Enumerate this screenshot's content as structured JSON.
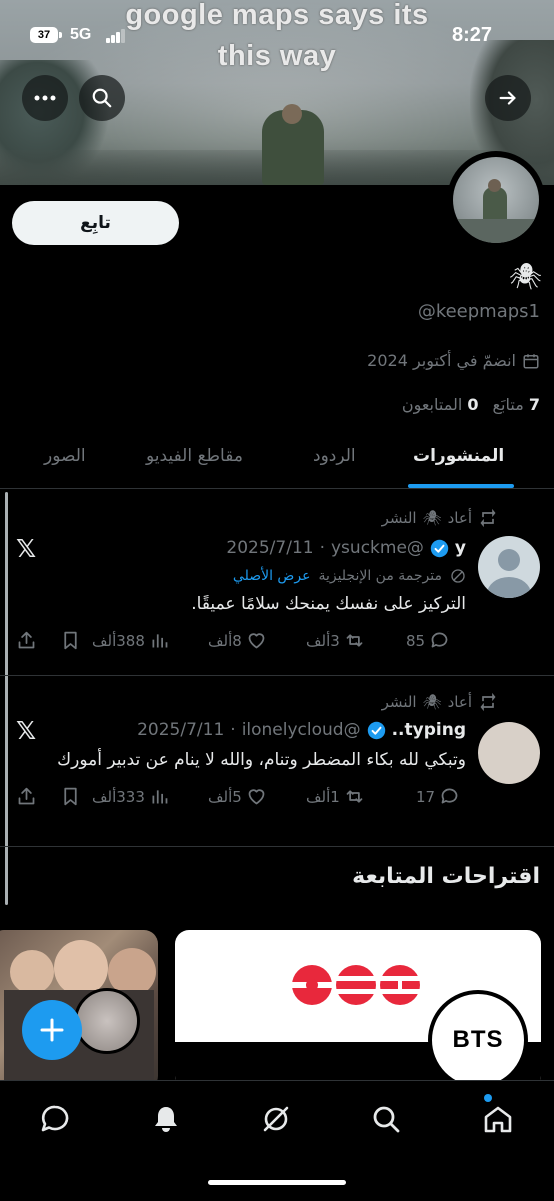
{
  "status_bar": {
    "time": "8:27",
    "battery": "37",
    "network": "5G"
  },
  "banner": {
    "line1": "google maps says its",
    "line2": "this way"
  },
  "header_icons": {
    "more": "more-icon",
    "search": "search-icon",
    "back": "arrow-icon"
  },
  "profile": {
    "follow_label": "تابِع",
    "emoji_name": "🕷",
    "handle": "@keepmaps1",
    "joined": "انضمّ في أكتوبر 2024",
    "following_count": "7",
    "following_label": "متابَع",
    "followers_count": "0",
    "followers_label": "المتابعون"
  },
  "tabs": [
    "المنشورات",
    "الردود",
    "مقاطع الفيديو",
    "الصور"
  ],
  "posts": [
    {
      "repost_prefix": "أعاد",
      "repost_emoji": "🕷",
      "repost_suffix": "النشر",
      "name": "y",
      "handle": "@ysuckme",
      "date": "2025/7/11",
      "translated_label": "مترجمة من الإنجليزية",
      "show_original": "عرض الأصلي",
      "text": "التركيز على نفسك يمنحك سلامًا عميقًا.",
      "replies": "85",
      "reposts": "3ألف",
      "likes": "8ألف",
      "views": "388ألف"
    },
    {
      "repost_prefix": "أعاد",
      "repost_emoji": "🕷",
      "repost_suffix": "النشر",
      "name": "typing..",
      "handle": "@ilonelycloud",
      "date": "2025/7/11",
      "text": "وتبكي لله بكاء المضطر وتنام، والله لا ينام عن تدبير أمورك",
      "replies": "17",
      "reposts": "1ألف",
      "likes": "5ألف",
      "views": "333ألف"
    }
  ],
  "suggestions": {
    "title": "اقتراحات المتابعة",
    "bts_label": "BTS"
  },
  "nav": [
    "home-icon",
    "search-icon",
    "grok-icon",
    "notifications-icon",
    "messages-icon"
  ],
  "colors": {
    "accent": "#1d9bf0",
    "bg": "#000000",
    "muted": "#71767b",
    "text": "#e7e9ea",
    "hybe_red": "#e8283c"
  }
}
